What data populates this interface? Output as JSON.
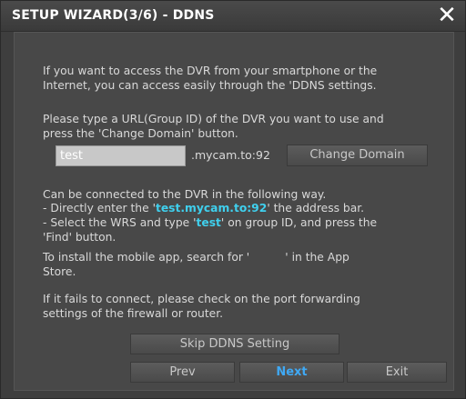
{
  "title": "SETUP WIZARD(3/6) - DDNS",
  "close_symbol": "✕",
  "colors": {
    "highlight": "#3fd0ee",
    "next_text": "#3fa9f5"
  },
  "intro": [
    "If you want to access the DVR from your smartphone or the",
    "Internet, you can access easily through the 'DDNS settings."
  ],
  "instruction": [
    "Please type a URL(Group ID) of the DVR you want to use and",
    "press the 'Change Domain' button."
  ],
  "group_id": {
    "value": "test",
    "suffix": ".mycam.to:92"
  },
  "change_domain_label": "Change Domain",
  "connect_info": {
    "line1": "Can be connected to the DVR in the following way.",
    "line2_prefix": "- Directly enter the '",
    "line2_highlight": "test.mycam.to:92",
    "line2_suffix": "' the address bar.",
    "line3_prefix": "- Select the WRS and type '",
    "line3_highlight": "test",
    "line3_suffix": "' on group ID, and press the",
    "line4": "'Find' button."
  },
  "mobile_app": {
    "line1": "To install the mobile app, search for '          ' in the App",
    "line2": "Store."
  },
  "fail_note": [
    "If it fails to connect, please check on the port forwarding",
    "settings of the firewall or router."
  ],
  "buttons": {
    "skip": "Skip DDNS Setting",
    "prev": "Prev",
    "next": "Next",
    "exit": "Exit"
  }
}
